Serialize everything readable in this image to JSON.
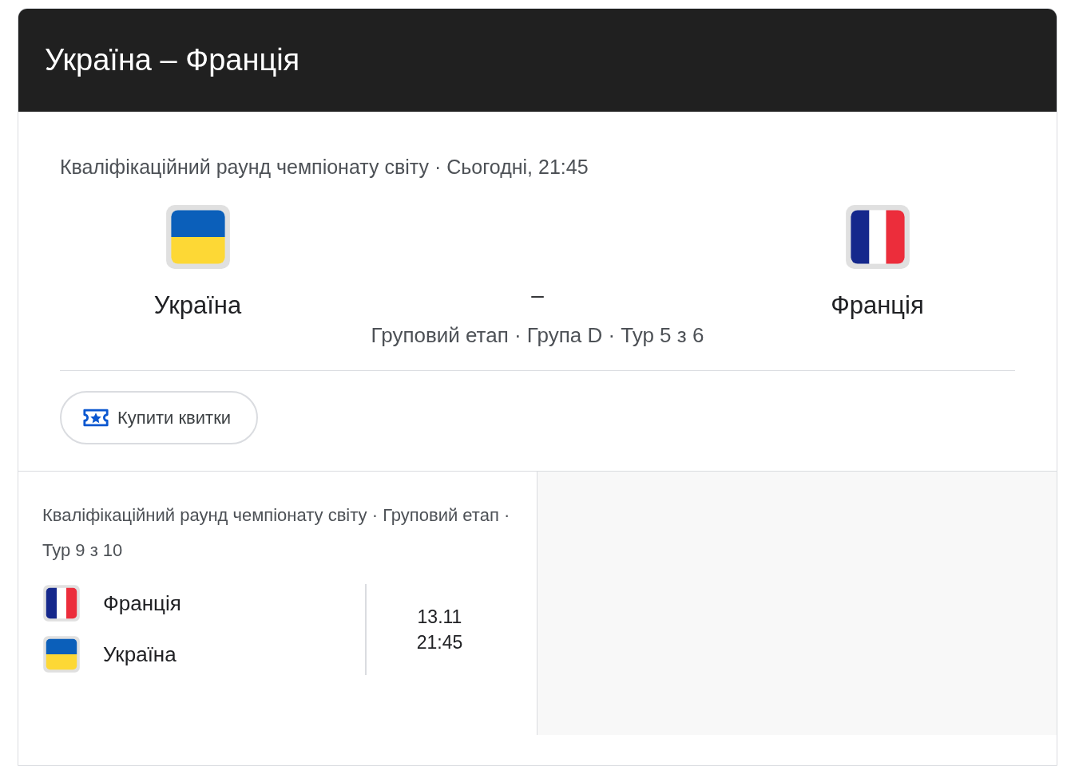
{
  "header": {
    "title": "Україна – Франція"
  },
  "match": {
    "info": "Кваліфікаційний раунд чемпіонату світу · Сьогодні, 21:45",
    "home": {
      "name": "Україна",
      "kind": "ukraine"
    },
    "score": "–",
    "away": {
      "name": "Франція",
      "kind": "france"
    },
    "stage": "Груповий етап · Група D · Тур 5 з 6",
    "tickets_button": "Купити квитки"
  },
  "next_match": {
    "info": "Кваліфікаційний раунд чемпіонату світу · Груповий етап · Тур 9 з 10",
    "teams": [
      {
        "name": "Франція",
        "kind": "france"
      },
      {
        "name": "Україна",
        "kind": "ukraine"
      }
    ],
    "date": "13.11",
    "time": "21:45"
  }
}
